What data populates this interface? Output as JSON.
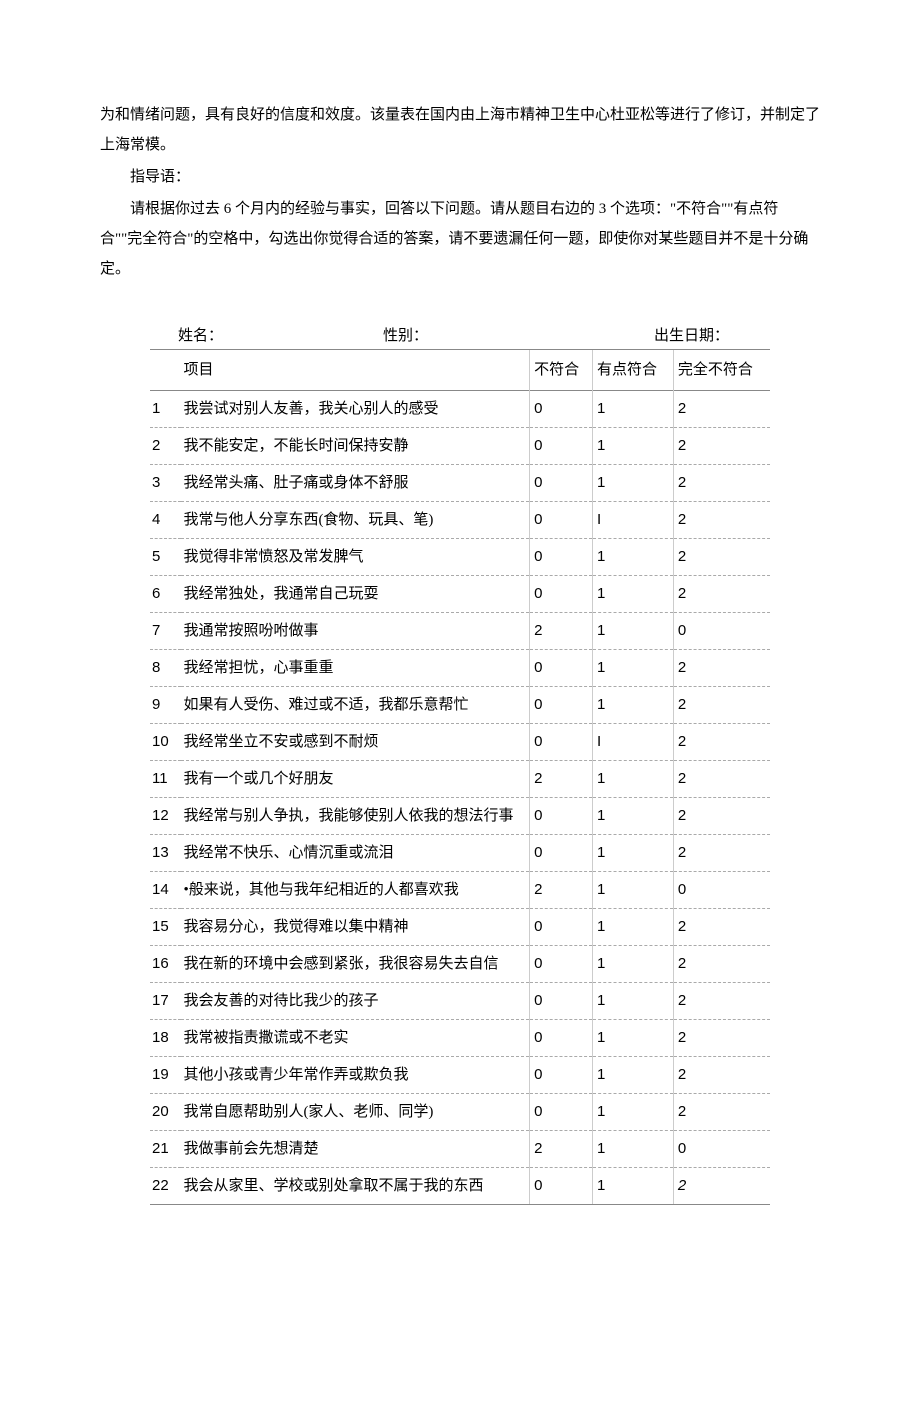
{
  "intro": {
    "p1": "为和情绪问题，具有良好的信度和效度。该量表在国内由上海市精神卫生中心杜亚松等进行了修订，并制定了上海常模。",
    "p2": "指导语：",
    "p3": "请根据你过去 6 个月内的经验与事实，回答以下问题。请从题目右边的 3 个选项：\"不符合\"\"有点符合\"\"完全符合\"的空格中，勾选出你觉得合适的答案，请不要遗漏任何一题，即使你对某些题目并不是十分确定。"
  },
  "form": {
    "name_label": "姓名：",
    "gender_label": "性别：",
    "birth_label": "出生日期：",
    "col_item": "项目",
    "col_c1": "不符合",
    "col_c2": "有点符合",
    "col_c3": "完全不符合",
    "rows": [
      {
        "n": "1",
        "item": "我尝试对别人友善，我关心别人的感受",
        "c1": "0",
        "c2": "1",
        "c3": "2"
      },
      {
        "n": "2",
        "item": "我不能安定，不能长时间保持安静",
        "c1": "0",
        "c2": "1",
        "c3": "2"
      },
      {
        "n": "3",
        "item": "我经常头痛、肚子痛或身体不舒服",
        "c1": "0",
        "c2": "1",
        "c3": "2"
      },
      {
        "n": "4",
        "item": "我常与他人分享东西(食物、玩具、笔)",
        "c1": "0",
        "c2": "I",
        "c3": "2"
      },
      {
        "n": "5",
        "item": "我觉得非常愤怒及常发脾气",
        "c1": "0",
        "c2": "1",
        "c3": "2"
      },
      {
        "n": "6",
        "item": "我经常独处，我通常自己玩耍",
        "c1": "0",
        "c2": "1",
        "c3": "2"
      },
      {
        "n": "7",
        "item": "我通常按照吩咐做事",
        "c1": "2",
        "c2": "1",
        "c3": "0"
      },
      {
        "n": "8",
        "item": "我经常担忧，心事重重",
        "c1": "0",
        "c2": "1",
        "c3": "2"
      },
      {
        "n": "9",
        "item": "如果有人受伤、难过或不适，我都乐意帮忙",
        "c1": "0",
        "c2": "1",
        "c3": "2"
      },
      {
        "n": "10",
        "item": "我经常坐立不安或感到不耐烦",
        "c1": "0",
        "c2": "I",
        "c3": "2"
      },
      {
        "n": "11",
        "item": "我有一个或几个好朋友",
        "c1": "2",
        "c2": "1",
        "c3": "2"
      },
      {
        "n": "12",
        "item": "我经常与别人争执，我能够使别人依我的想法行事",
        "c1": "0",
        "c2": "1",
        "c3": "2"
      },
      {
        "n": "13",
        "item": "我经常不快乐、心情沉重或流泪",
        "c1": "0",
        "c2": "1",
        "c3": "2"
      },
      {
        "n": "14",
        "item": "•般来说，其他与我年纪相近的人都喜欢我",
        "c1": "2",
        "c2": "1",
        "c3": "0"
      },
      {
        "n": "15",
        "item": "我容易分心，我觉得难以集中精神",
        "c1": "0",
        "c2": "1",
        "c3": "2"
      },
      {
        "n": "16",
        "item": "我在新的环境中会感到紧张，我很容易失去自信",
        "c1": "0",
        "c2": "1",
        "c3": "2"
      },
      {
        "n": "17",
        "item": "我会友善的对待比我少的孩子",
        "c1": "0",
        "c2": "1",
        "c3": "2"
      },
      {
        "n": "18",
        "item": "我常被指责撒谎或不老实",
        "c1": "0",
        "c2": "1",
        "c3": "2"
      },
      {
        "n": "19",
        "item": "其他小孩或青少年常作弄或欺负我",
        "c1": "0",
        "c2": "1",
        "c3": "2"
      },
      {
        "n": "20",
        "item": "我常自愿帮助别人(家人、老师、同学)",
        "c1": "0",
        "c2": "1",
        "c3": "2"
      },
      {
        "n": "21",
        "item": "我做事前会先想清楚",
        "c1": "2",
        "c2": "1",
        "c3": "0"
      },
      {
        "n": "22",
        "item": "我会从家里、学校或别处拿取不属于我的东西",
        "c1": "0",
        "c2": "1",
        "c3": "2"
      }
    ]
  }
}
